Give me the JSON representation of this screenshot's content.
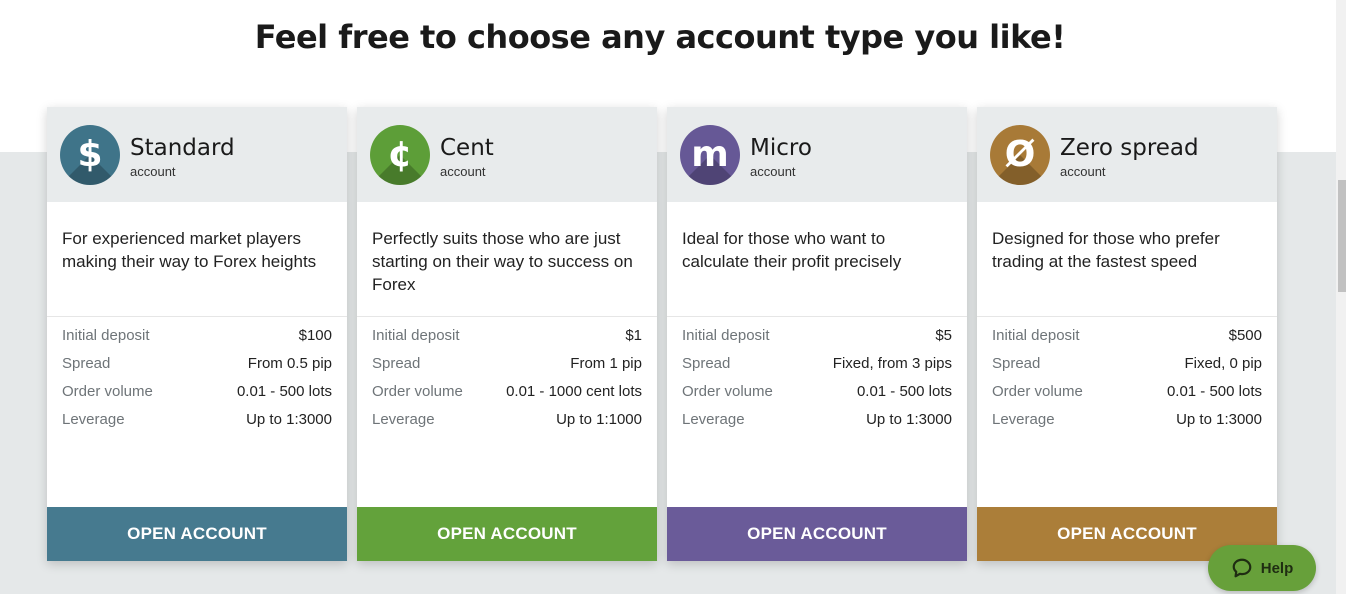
{
  "headline": "Feel free to choose any account type you like!",
  "cards": [
    {
      "name": "Standard",
      "sub": "account",
      "icon": "dollar-icon",
      "glyph": "$",
      "color": "#3f7489",
      "button_color": "#467a8f",
      "description": "For experienced market players making their way to Forex heights",
      "specs": [
        {
          "label": "Initial deposit",
          "value": "$100"
        },
        {
          "label": "Spread",
          "value": "From 0.5 pip"
        },
        {
          "label": "Order volume",
          "value": "0.01 - 500 lots"
        },
        {
          "label": "Leverage",
          "value": "Up to 1:3000"
        }
      ],
      "button": "OPEN ACCOUNT"
    },
    {
      "name": "Cent",
      "sub": "account",
      "icon": "cent-icon",
      "glyph": "¢",
      "color": "#5d9e38",
      "button_color": "#63a23b",
      "description": "Perfectly suits those who are just starting on their way to success on Forex",
      "specs": [
        {
          "label": "Initial deposit",
          "value": "$1"
        },
        {
          "label": "Spread",
          "value": "From 1 pip"
        },
        {
          "label": "Order volume",
          "value": "0.01 - 1000 cent lots"
        },
        {
          "label": "Leverage",
          "value": "Up to 1:1000"
        }
      ],
      "button": "OPEN ACCOUNT"
    },
    {
      "name": "Micro",
      "sub": "account",
      "icon": "micro-m-icon",
      "glyph": "m",
      "color": "#665896",
      "button_color": "#6a5b99",
      "description": "Ideal for those who want to calculate their profit precisely",
      "specs": [
        {
          "label": "Initial deposit",
          "value": "$5"
        },
        {
          "label": "Spread",
          "value": "Fixed, from 3 pips"
        },
        {
          "label": "Order volume",
          "value": "0.01 - 500 lots"
        },
        {
          "label": "Leverage",
          "value": "Up to 1:3000"
        }
      ],
      "button": "OPEN ACCOUNT"
    },
    {
      "name": "Zero spread",
      "sub": "account",
      "icon": "zero-slash-icon",
      "glyph": "Ø",
      "color": "#a87a37",
      "button_color": "#ab7e39",
      "description": "Designed for those who prefer trading at the fastest speed",
      "specs": [
        {
          "label": "Initial deposit",
          "value": "$500"
        },
        {
          "label": "Spread",
          "value": "Fixed, 0 pip"
        },
        {
          "label": "Order volume",
          "value": "0.01 - 500 lots"
        },
        {
          "label": "Leverage",
          "value": "Up to 1:3000"
        }
      ],
      "button": "OPEN ACCOUNT"
    }
  ],
  "help": {
    "label": "Help",
    "icon": "chat-bubble-icon",
    "color": "#67a03a"
  }
}
